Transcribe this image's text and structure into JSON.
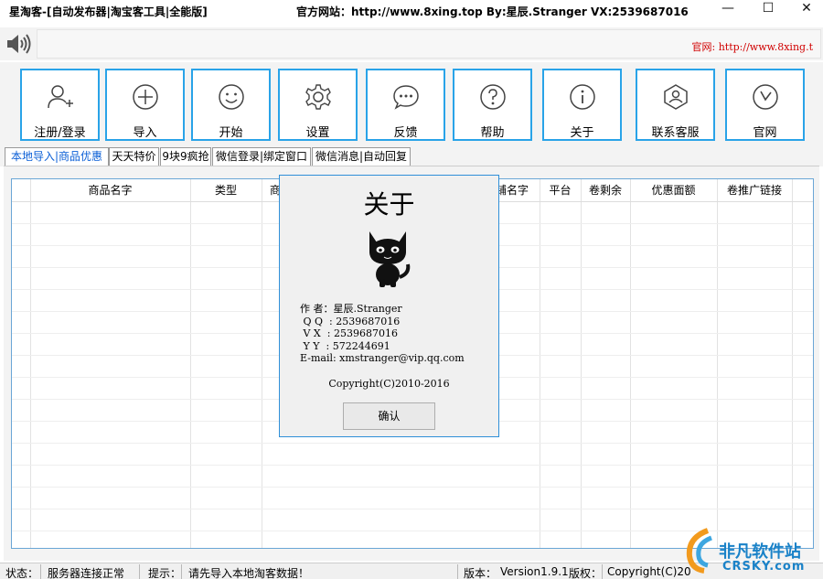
{
  "window": {
    "title": "星淘客-[自动发布器|淘宝客工具|全能版]",
    "center_info": "官方网站：http://www.8xing.top    By:星辰.Stranger   VX:2539687016",
    "minimize_label": "—",
    "maximize_label": "☐",
    "close_label": "✕"
  },
  "marquee": {
    "text": "官网: http://www.8xing.t"
  },
  "toolbar": {
    "buttons": [
      {
        "label": "注册/登录",
        "icon": "user-add-icon"
      },
      {
        "label": "导入",
        "icon": "plus-circle-icon"
      },
      {
        "label": "开始",
        "icon": "smiley-icon"
      },
      {
        "label": "设置",
        "icon": "gear-icon"
      },
      {
        "label": "反馈",
        "icon": "chat-icon"
      },
      {
        "label": "帮助",
        "icon": "question-icon"
      },
      {
        "label": "关于",
        "icon": "info-icon"
      },
      {
        "label": "联系客服",
        "icon": "support-icon"
      },
      {
        "label": "官网",
        "icon": "clock-icon"
      }
    ]
  },
  "tabs": [
    {
      "label": "本地导入|商品优惠",
      "active": true
    },
    {
      "label": "天天特价",
      "active": false
    },
    {
      "label": "9块9疯抢",
      "active": false
    },
    {
      "label": "微信登录|绑定窗口",
      "active": false
    },
    {
      "label": "微信消息|自动回复",
      "active": false
    }
  ],
  "table": {
    "columns": [
      "商品名字",
      "类型",
      "商",
      "铺名字",
      "平台",
      "卷剩余",
      "优惠面额",
      "卷推广链接"
    ]
  },
  "about_dialog": {
    "title": "关于",
    "info": "作 者：星辰.Stranger\n Q Q  : 2539687016\n V X  : 2539687016\n Y Y  : 572244691\nE-mail: xmstranger@vip.qq.com",
    "copyright": "Copyright(C)2010-2016",
    "ok_label": "确认"
  },
  "statusbar": {
    "status_label": "状态：",
    "status_value": "服务器连接正常",
    "hint_label": "提示：",
    "hint_value": "请先导入本地淘客数据！",
    "version_label": "版本：",
    "version_value": "Version1.9.1",
    "copyright_label": "版权：",
    "copyright_value": "Copyright(C)20"
  },
  "watermark": {
    "line1": "非凡软件站",
    "line2": "CRSKY.com"
  },
  "colors": {
    "accent_border": "#29a3e8",
    "marquee_text": "#d00000",
    "active_tab": "#0b5fd6"
  }
}
